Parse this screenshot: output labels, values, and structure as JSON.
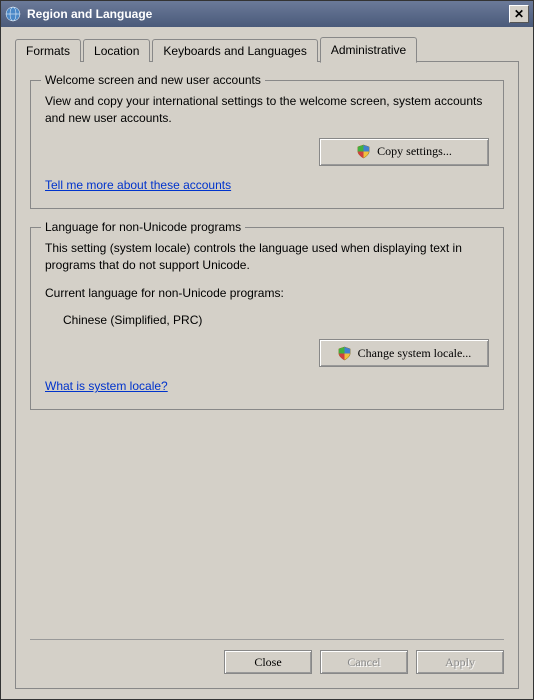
{
  "window": {
    "title": "Region and Language",
    "close": "✕"
  },
  "tabs": {
    "formats": "Formats",
    "location": "Location",
    "keyboards": "Keyboards and Languages",
    "administrative": "Administrative"
  },
  "group1": {
    "title": "Welcome screen and new user accounts",
    "desc": "View and copy your international settings to the welcome screen, system accounts and new user accounts.",
    "button": "Copy settings...",
    "link": "Tell me more about these accounts"
  },
  "group2": {
    "title": "Language for non-Unicode programs",
    "desc": "This setting (system locale) controls the language used when displaying text in programs that do not support Unicode.",
    "current_label": "Current language for non-Unicode programs:",
    "current_value": "Chinese (Simplified, PRC)",
    "button": "Change system locale...",
    "link": "What is system locale?"
  },
  "buttons": {
    "close": "Close",
    "cancel": "Cancel",
    "apply": "Apply"
  }
}
